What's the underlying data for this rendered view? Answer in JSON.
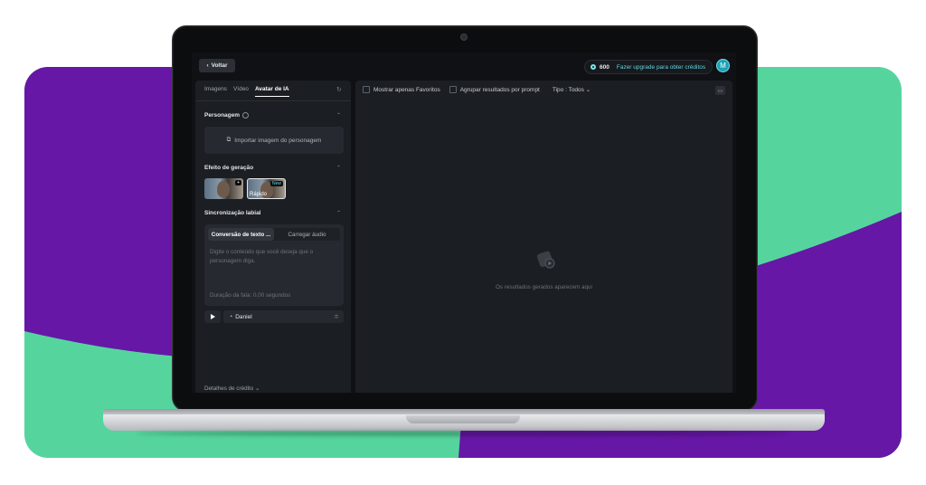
{
  "colors": {
    "purple": "#6617a6",
    "green": "#55d59d",
    "accent": "#5fd7e3"
  },
  "topbar": {
    "back_label": "Voltar",
    "credits": "600",
    "upgrade_label": "Fazer upgrade para obter créditos",
    "avatar_initial": "M"
  },
  "left": {
    "tabs": [
      "Imagens",
      "Vídeo",
      "Avatar de IA"
    ],
    "character": {
      "title": "Personagem",
      "import_label": "Importar imagem do personagem"
    },
    "effect": {
      "title": "Efeito de geração",
      "thumb2_label": "Rápido",
      "thumb2_badge": "New"
    },
    "lipsync": {
      "title": "Sincronização labial",
      "tab_text": "Conversão de texto ...",
      "tab_audio": "Carregar áudio",
      "placeholder": "Digite o conteúdo que você deseja que o personagem diga.",
      "duration": "Duração da fala: 0,00 segundos",
      "voice": "Daniel"
    },
    "credit_details": "Detalhes de crédito"
  },
  "right": {
    "show_favorites": "Mostrar apenas Favoritos",
    "group_results": "Agrupar resultados por prompt",
    "type_filter": "Tipo : Todos",
    "empty_text": "Os resultados gerados aparecem aqui"
  }
}
